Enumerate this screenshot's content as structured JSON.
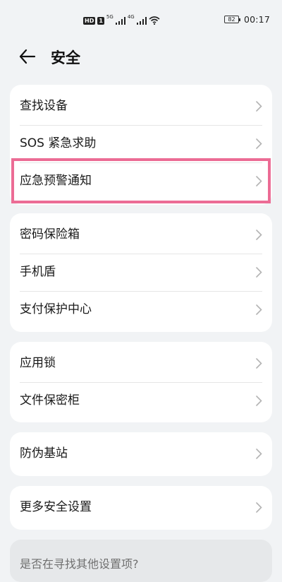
{
  "status_bar": {
    "network_badge": "HD",
    "sim_label": "1",
    "net_type_1": "5G",
    "net_type_2": "4G",
    "battery": "82",
    "time": "00:17"
  },
  "header": {
    "back_icon": "back-arrow-icon",
    "title": "安全"
  },
  "groups": [
    {
      "items": [
        {
          "label": "查找设备"
        },
        {
          "label": "SOS 紧急求助"
        },
        {
          "label": "应急预警通知",
          "highlighted": true
        }
      ]
    },
    {
      "items": [
        {
          "label": "密码保险箱"
        },
        {
          "label": "手机盾"
        },
        {
          "label": "支付保护中心"
        }
      ]
    },
    {
      "items": [
        {
          "label": "应用锁"
        },
        {
          "label": "文件保密柜"
        }
      ]
    },
    {
      "items": [
        {
          "label": "防伪基站"
        }
      ]
    },
    {
      "items": [
        {
          "label": "更多安全设置"
        }
      ]
    }
  ],
  "hint": {
    "text": "是否在寻找其他设置项?"
  },
  "colors": {
    "background": "#f1f3f5",
    "card": "#ffffff",
    "highlight": "#ec6c95",
    "chevron": "#b3b3b3"
  }
}
